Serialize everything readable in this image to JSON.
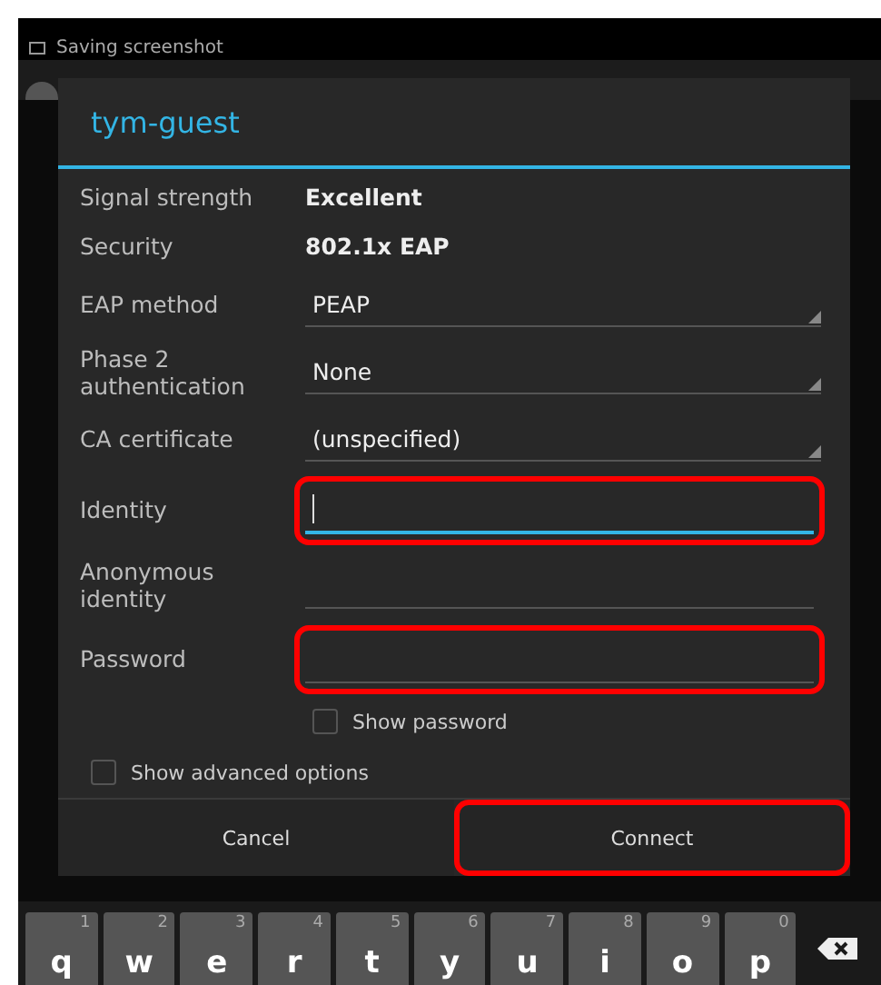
{
  "status_bar": {
    "notification": "Saving screenshot"
  },
  "dialog": {
    "title": "tym-guest",
    "rows": [
      {
        "kind": "info",
        "label": "Signal strength",
        "value": "Excellent"
      },
      {
        "kind": "info",
        "label": "Security",
        "value": "802.1x EAP"
      },
      {
        "kind": "dropdown",
        "label": "EAP method",
        "value": "PEAP"
      },
      {
        "kind": "dropdown",
        "label": "Phase 2 authentication",
        "value": "None"
      },
      {
        "kind": "dropdown",
        "label": "CA certificate",
        "value": "(unspecified)"
      },
      {
        "kind": "text",
        "label": "Identity",
        "focused": true,
        "highlighted": true
      },
      {
        "kind": "text",
        "label": "Anonymous identity",
        "focused": false,
        "highlighted": false
      },
      {
        "kind": "text",
        "label": "Password",
        "focused": false,
        "highlighted": true
      }
    ],
    "show_password": {
      "label": "Show password",
      "checked": false
    },
    "advanced_options": {
      "label": "Show advanced options",
      "checked": false
    },
    "buttons": [
      {
        "label": "Cancel",
        "highlighted": false
      },
      {
        "label": "Connect",
        "highlighted": true
      }
    ]
  },
  "keyboard": {
    "keys": [
      {
        "letter": "q",
        "hint": "1"
      },
      {
        "letter": "w",
        "hint": "2"
      },
      {
        "letter": "e",
        "hint": "3"
      },
      {
        "letter": "r",
        "hint": "4"
      },
      {
        "letter": "t",
        "hint": "5"
      },
      {
        "letter": "y",
        "hint": "6"
      },
      {
        "letter": "u",
        "hint": "7"
      },
      {
        "letter": "i",
        "hint": "8"
      },
      {
        "letter": "o",
        "hint": "9"
      },
      {
        "letter": "p",
        "hint": "0"
      }
    ]
  }
}
